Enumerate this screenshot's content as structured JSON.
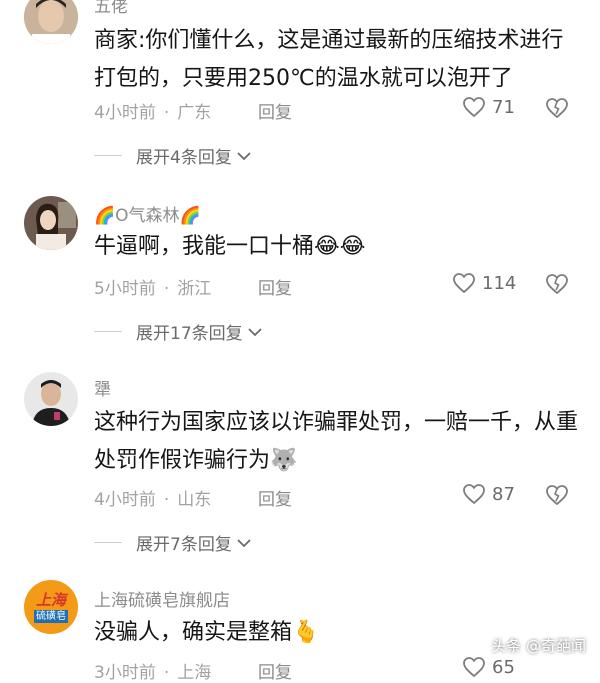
{
  "comments": [
    {
      "username": "五佬",
      "text": "商家:你们懂什么，这是通过最新的压缩技术进行打包的，只要用250℃的温水就可以泡开了",
      "time": "4小时前",
      "location": "广东",
      "reply": "回复",
      "likes": "71",
      "expand": "展开4条回复"
    },
    {
      "username_prefix": "🌈",
      "username": "O气森林",
      "username_suffix": "🌈",
      "text": "牛逼啊，我能一口十桶",
      "emojis": "😂😂",
      "time": "5小时前",
      "location": "浙江",
      "reply": "回复",
      "likes": "114",
      "expand": "展开17条回复"
    },
    {
      "username": "犟",
      "text": "这种行为国家应该以诈骗罪处罚，一赔一千，从重处罚作假诈骗行为",
      "emojis": "🐺",
      "time": "4小时前",
      "location": "山东",
      "reply": "回复",
      "likes": "87",
      "expand": "展开7条回复"
    },
    {
      "username": "上海硫磺皂旗舰店",
      "avatar_text_top": "上海",
      "avatar_text_bottom": "硫磺皂",
      "text": "没骗人，确实是整箱",
      "emojis": "🫰",
      "time": "3小时前",
      "location": "上海",
      "reply": "回复",
      "likes": "65"
    }
  ],
  "watermark": "头条 @奇葩闻",
  "colors": {
    "primary_text": "#161616",
    "meta_text": "#a2a2a2",
    "brand_orange": "#f39a17",
    "brand_red": "#d9352b"
  }
}
